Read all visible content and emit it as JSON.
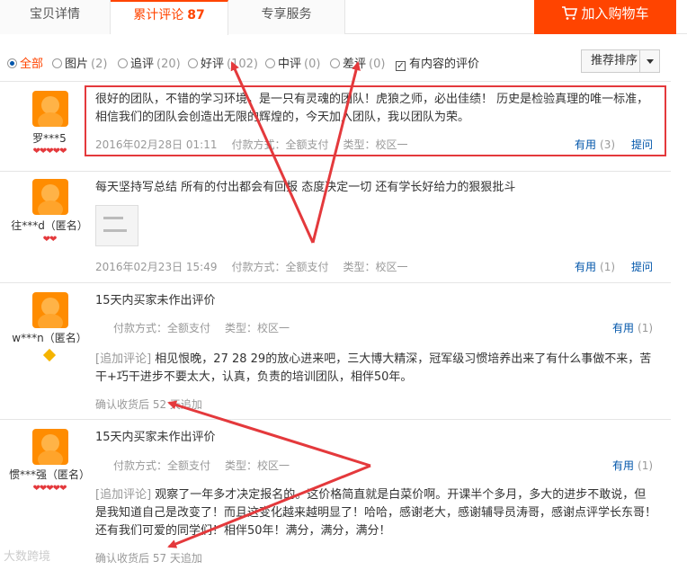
{
  "tabs": {
    "details": "宝贝详情",
    "reviews": "累计评论",
    "reviews_count": "87",
    "service": "专享服务",
    "add_cart": "加入购物车"
  },
  "filters": {
    "all": "全部",
    "pic": "图片",
    "pic_n": "(2)",
    "append": "追评",
    "append_n": "(20)",
    "good": "好评",
    "good_n": "(102)",
    "mid": "中评",
    "mid_n": "(0)",
    "bad": "差评",
    "bad_n": "(0)",
    "has_content": "有内容的评价",
    "sort": "推荐排序"
  },
  "reviews": [
    {
      "user": "罗***5",
      "hearts": "❤❤❤❤❤",
      "text": "很好的团队，不错的学习环境，是一只有灵魂的团队！虎狼之师，必出佳绩！ 历史是检验真理的唯一标准，相信我们的团队会创造出无限的辉煌的，今天加入团队，我以团队为荣。",
      "date": "2016年02月28日 01:11",
      "pay": "付款方式：全额支付",
      "type": "类型：校区一",
      "useful": "有用",
      "useful_n": "(3)",
      "reply": "提问"
    },
    {
      "user": "往***d（匿名）",
      "hearts": "❤❤",
      "text": "每天坚持写总结 所有的付出都会有回报 态度决定一切 还有学长好给力的狠狠批斗",
      "date": "2016年02月23日 15:49",
      "pay": "付款方式：全额支付",
      "type": "类型：校区一",
      "useful": "有用",
      "useful_n": "(1)",
      "reply": "提问"
    },
    {
      "user": "w***n（匿名）",
      "text": "15天内买家未作出评价",
      "pay": "付款方式：全额支付",
      "type": "类型：校区一",
      "useful": "有用",
      "useful_n": "(1)",
      "append_label": "[追加评论]",
      "append_text": "相见恨晚，27 28 29的放心进来吧，三大博大精深，冠军级习惯培养出来了有什么事做不来，苦干+巧干进步不要太大，认真，负责的培训团队，相伴50年。",
      "follow": "确认收货后 52 天追加"
    },
    {
      "user": "惯***强（匿名）",
      "hearts": "❤❤❤❤❤",
      "text": "15天内买家未作出评价",
      "pay": "付款方式：全额支付",
      "type": "类型：校区一",
      "useful": "有用",
      "useful_n": "(1)",
      "append_label": "[追加评论]",
      "append_text": "观察了一年多才决定报名的。这价格简直就是白菜价啊。开课半个多月，多大的进步不敢说，但是我知道自己是改变了！而且这变化越来越明显了！哈哈，感谢老大，感谢辅导员涛哥，感谢点评学长东哥！还有我们可爱的同学们！相伴50年！满分，满分，满分！",
      "follow": "确认收货后 57 天追加"
    }
  ],
  "watermark": "大数跨境",
  "colors": {
    "accent": "#ff4400",
    "link": "#0055aa",
    "annotation": "#e4393c"
  }
}
